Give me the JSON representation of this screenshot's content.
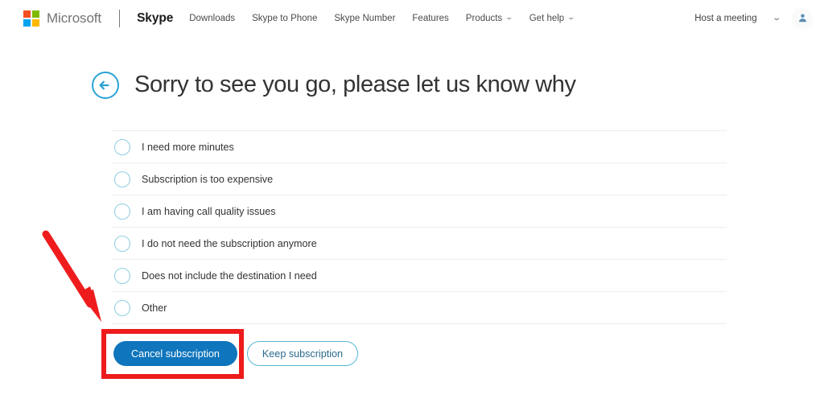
{
  "header": {
    "brand": "Microsoft",
    "product": "Skype",
    "logo_colors": [
      "#f25022",
      "#7fba00",
      "#00a4ef",
      "#ffb900"
    ],
    "nav_items": [
      {
        "label": "Downloads",
        "has_caret": false
      },
      {
        "label": "Skype to Phone",
        "has_caret": false
      },
      {
        "label": "Skype Number",
        "has_caret": false
      },
      {
        "label": "Features",
        "has_caret": false
      },
      {
        "label": "Products",
        "has_caret": true
      },
      {
        "label": "Get help",
        "has_caret": true
      }
    ],
    "host_meeting": "Host a meeting",
    "caret_glyph": "⌄",
    "avatar_icon": "person-icon"
  },
  "main": {
    "back_icon": "back-arrow-circle-icon",
    "title": "Sorry to see you go, please let us know why",
    "options": [
      {
        "label": "I need more minutes",
        "selected": false
      },
      {
        "label": "Subscription is too expensive",
        "selected": false
      },
      {
        "label": "I am having call quality issues",
        "selected": false
      },
      {
        "label": "I do not need the subscription anymore",
        "selected": false
      },
      {
        "label": "Does not include the destination I need",
        "selected": false
      },
      {
        "label": "Other",
        "selected": false
      }
    ],
    "buttons": {
      "primary": "Cancel subscription",
      "secondary": "Keep subscription"
    }
  },
  "colors": {
    "primary_button": "#0f75bc",
    "secondary_border": "#57b6d6",
    "radio_border": "#8ecfe0",
    "back_arrow": "#29a3d6",
    "annotation_red": "#ee1c1c",
    "divider": "#ededed",
    "text": "#333333"
  },
  "annotations": {
    "highlight_box_target": "Cancel subscription",
    "arrow_points_to": "Cancel subscription"
  }
}
